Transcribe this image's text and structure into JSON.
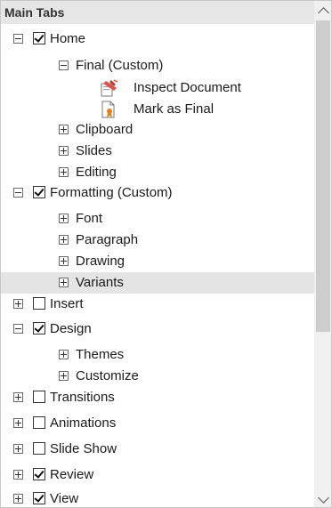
{
  "header": {
    "title": "Main Tabs"
  },
  "tree": [
    {
      "label": "Home",
      "toggle": "minus",
      "checked": true
    },
    {
      "label": "Final (Custom)",
      "toggle": "minus"
    },
    {
      "label": "Inspect Document",
      "icon": "inspect-document-icon"
    },
    {
      "label": "Mark as Final",
      "icon": "mark-as-final-icon"
    },
    {
      "label": "Clipboard",
      "toggle": "plus"
    },
    {
      "label": "Slides",
      "toggle": "plus"
    },
    {
      "label": "Editing",
      "toggle": "plus"
    },
    {
      "label": "Formatting (Custom)",
      "toggle": "minus",
      "checked": true
    },
    {
      "label": "Font",
      "toggle": "plus"
    },
    {
      "label": "Paragraph",
      "toggle": "plus"
    },
    {
      "label": "Drawing",
      "toggle": "plus"
    },
    {
      "label": "Variants",
      "toggle": "plus",
      "selected": true
    },
    {
      "label": "Insert",
      "toggle": "plus",
      "checked": false
    },
    {
      "label": "Design",
      "toggle": "minus",
      "checked": true
    },
    {
      "label": "Themes",
      "toggle": "plus"
    },
    {
      "label": "Customize",
      "toggle": "plus"
    },
    {
      "label": "Transitions",
      "toggle": "plus",
      "checked": false
    },
    {
      "label": "Animations",
      "toggle": "plus",
      "checked": false
    },
    {
      "label": "Slide Show",
      "toggle": "plus",
      "checked": false
    },
    {
      "label": "Review",
      "toggle": "plus",
      "checked": true
    },
    {
      "label": "View",
      "toggle": "plus",
      "checked": true
    }
  ],
  "colors": {
    "selected_row": "#e4e4e4",
    "scroll_thumb": "#cdcdcd",
    "header_bg": "#e6e6e6"
  },
  "scrollbar": {
    "up_icon": "chevron-up-icon",
    "down_icon": "chevron-down-icon"
  }
}
